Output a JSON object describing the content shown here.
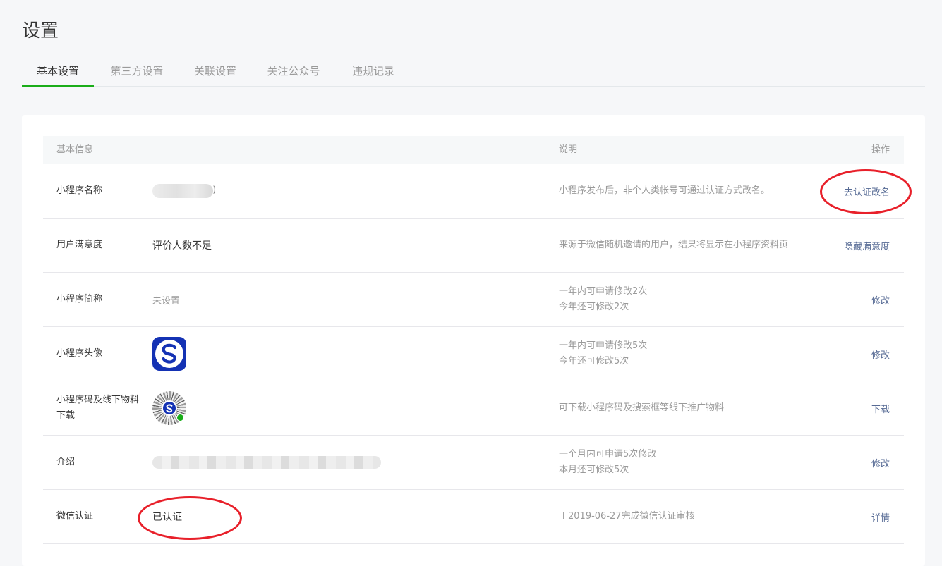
{
  "page": {
    "title": "设置"
  },
  "tabs": [
    {
      "label": "基本设置",
      "active": true
    },
    {
      "label": "第三方设置",
      "active": false
    },
    {
      "label": "关联设置",
      "active": false
    },
    {
      "label": "关注公众号",
      "active": false
    },
    {
      "label": "违规记录",
      "active": false
    }
  ],
  "table": {
    "headers": {
      "info": "基本信息",
      "desc": "说明",
      "op": "操作"
    },
    "rows": [
      {
        "label": "小程序名称",
        "value": "",
        "desc": [
          "小程序发布后，非个人类帐号可通过认证方式改名。"
        ],
        "op": "去认证改名"
      },
      {
        "label": "用户满意度",
        "value": "评价人数不足",
        "desc": [
          "来源于微信随机邀请的用户，结果将显示在小程序资料页"
        ],
        "op": "隐藏满意度"
      },
      {
        "label": "小程序简称",
        "value": "未设置",
        "desc": [
          "一年内可申请修改2次",
          "今年还可修改2次"
        ],
        "op": "修改"
      },
      {
        "label": "小程序头像",
        "value": "",
        "desc": [
          "一年内可申请修改5次",
          "今年还可修改5次"
        ],
        "op": "修改"
      },
      {
        "label": "小程序码及线下物料下载",
        "value": "",
        "desc": [
          "可下载小程序码及搜索框等线下推广物料"
        ],
        "op": "下载"
      },
      {
        "label": "介绍",
        "value": "",
        "desc": [
          "一个月内可申请5次修改",
          "本月还可修改5次"
        ],
        "op": "修改"
      },
      {
        "label": "微信认证",
        "value": "已认证",
        "desc": [
          "于2019-06-27完成微信认证审核"
        ],
        "op": "详情"
      }
    ]
  },
  "avatar": {
    "letter": "S",
    "color": "#1432b4"
  },
  "colors": {
    "accent": "#1aad19",
    "link": "#576b95",
    "annotation": "#e8202a"
  }
}
